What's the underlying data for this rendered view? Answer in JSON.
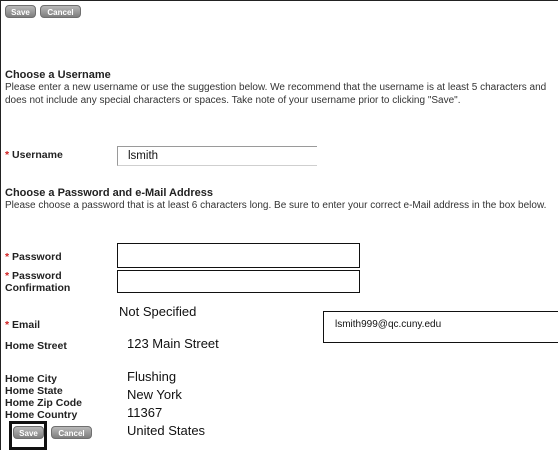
{
  "top_buttons": {
    "save": "Save",
    "cancel": "Cancel"
  },
  "username_section": {
    "title": "Choose a Username",
    "description": "Please enter a new username or use the suggestion below.  We recommend that the username is at least 5 characters and does not include any special characters or spaces. Take note of your username prior to clicking \"Save\".",
    "label": "Username",
    "value": "lsmith"
  },
  "password_section": {
    "title": "Choose a Password and e-Mail Address",
    "description": "Please choose a password that is at least 6 characters long. Be sure to enter your correct e-Mail address in the box below.",
    "password_label": "Password",
    "confirm_label_line1": "Password",
    "confirm_label_line2": "Confirmation",
    "email_label": "Email",
    "email_value": "lsmith999@qc.cuny.edu"
  },
  "address": {
    "not_specified": "Not Specified",
    "street_label": "Home Street",
    "street_value": "123 Main Street",
    "city_label": "Home City",
    "city_value": "Flushing",
    "state_label": "Home State",
    "state_value": "New York",
    "zip_label": "Home Zip Code",
    "zip_value": "11367",
    "country_label": "Home Country",
    "country_value": "United States"
  },
  "bottom_buttons": {
    "save": "Save",
    "cancel": "Cancel"
  },
  "required_marker": "*"
}
